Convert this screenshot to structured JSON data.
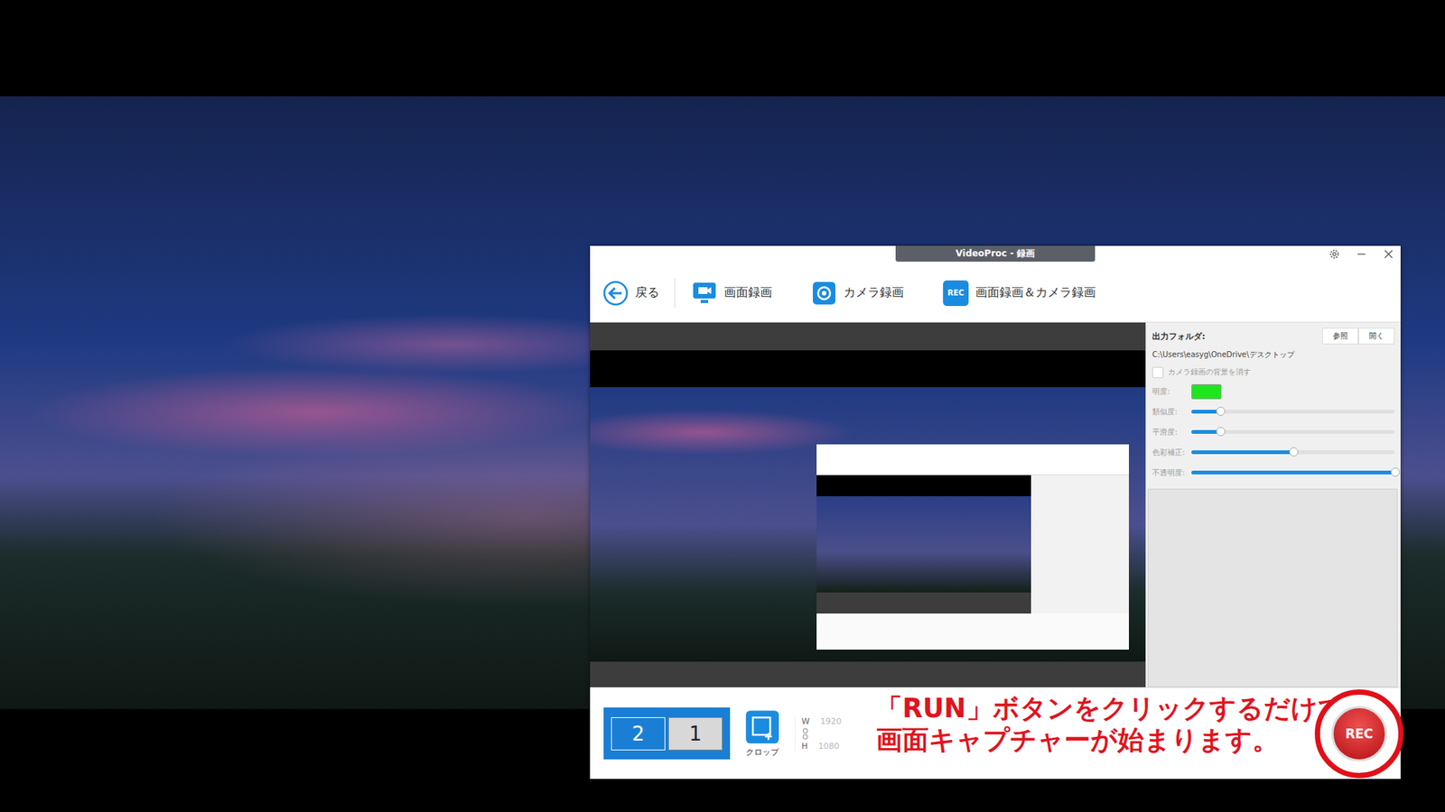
{
  "window": {
    "title": "VideoProc - 録画"
  },
  "toolbar": [
    {
      "label": "戻る",
      "kind": "back",
      "badge": ""
    },
    {
      "label": "画面録画",
      "kind": "screen",
      "badge": ""
    },
    {
      "label": "カメラ録画",
      "kind": "camera",
      "badge": ""
    },
    {
      "label": "画面録画＆カメラ録画",
      "kind": "both",
      "badge": "REC"
    }
  ],
  "settings": {
    "output_label": "出力フォルダ:",
    "buttons": [
      "参照",
      "開く"
    ],
    "path": "C:\\Users\\easyg\\OneDrive\\デスクトップ",
    "remove_bg": {
      "label": "カメラ録画の背景を消す",
      "checked": false
    },
    "key_color": {
      "label": "明度:",
      "color": "#1ee61e"
    },
    "sliders": [
      {
        "label": "類似度:",
        "level": 0.14
      },
      {
        "label": "平滑度:",
        "level": 0.14
      },
      {
        "label": "色彩補正:",
        "level": 0.5
      },
      {
        "label": "不透明度:",
        "level": 1.0
      }
    ]
  },
  "monitors": [
    {
      "label": "2",
      "selected": true
    },
    {
      "label": "1",
      "selected": false
    }
  ],
  "crop": {
    "label": "クロップ"
  },
  "size": {
    "w_label": "W",
    "w": "1920",
    "h_label": "H",
    "h": "1080",
    "disabled": true
  },
  "annotation": {
    "lines": [
      "「RUN」ボタンをクリックするだけで",
      "画面キャプチャーが始まります。"
    ]
  },
  "rec_button": {
    "label": "REC"
  }
}
